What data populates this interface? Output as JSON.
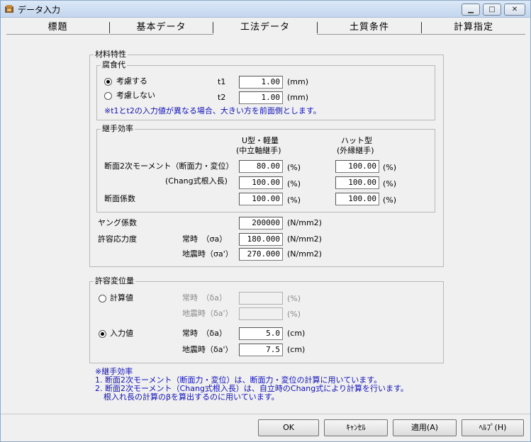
{
  "window": {
    "title": "データ入力"
  },
  "tabs": [
    {
      "label": "標題"
    },
    {
      "label": "基本データ"
    },
    {
      "label": "工法データ"
    },
    {
      "label": "土質条件"
    },
    {
      "label": "計算指定"
    }
  ],
  "material": {
    "title": "材料特性",
    "corrosion": {
      "title": "腐食代",
      "opt_consider": "考慮する",
      "opt_not_consider": "考慮しない",
      "t1_label": "t1",
      "t1_value": "1.00",
      "t1_unit": "(mm)",
      "t2_label": "t2",
      "t2_value": "1.00",
      "t2_unit": "(mm)",
      "note": "※t1とt2の入力値が異なる場合、大きい方を前面側とします。"
    },
    "joint": {
      "title": "継手効率",
      "col1_line1": "U型・軽量",
      "col1_line2": "(中立軸継手)",
      "col2_line1": "ハット型",
      "col2_line2": "(外縁継手)",
      "row1_label": "断面2次モーメント（断面力・変位）",
      "row2_label": "(Chang式根入長)",
      "row3_label": "断面係数",
      "row1_v1": "80.00",
      "row1_v2": "100.00",
      "row2_v1": "100.00",
      "row2_v2": "100.00",
      "row3_v1": "100.00",
      "row3_v2": "100.00",
      "unit": "(%)"
    },
    "young_label": "ヤング係数",
    "young_value": "200000",
    "young_unit": "(N/mm2)",
    "allow_stress_label": "許容応力度",
    "normal_label": "常時　（σa）",
    "normal_value": "180.000",
    "normal_unit": "(N/mm2)",
    "quake_label": "地震時（σa'）",
    "quake_value": "270.000",
    "quake_unit": "(N/mm2)"
  },
  "displacement": {
    "title": "許容変位量",
    "opt_calc": "計算値",
    "calc_normal_label": "常時　（δa）",
    "calc_normal_unit": "(%)",
    "calc_quake_label": "地震時（δa'）",
    "calc_quake_unit": "(%)",
    "opt_input": "入力値",
    "input_normal_label": "常時　（δa）",
    "input_normal_value": "5.0",
    "input_normal_unit": "(cm)",
    "input_quake_label": "地震時（δa'）",
    "input_quake_value": "7.5",
    "input_quake_unit": "(cm)"
  },
  "notes": {
    "line1": "※継手効率",
    "line2": "1. 断面2次モーメント（断面力・変位）は、断面力・変位の計算に用いています。",
    "line3": "2. 断面2次モーメント（Chang式根入長）は、自立時のChang式により計算を行います。",
    "line4": "根入れ長の計算のβを算出するのに用いています。"
  },
  "buttons": {
    "ok": "OK",
    "cancel": "ｷｬﾝｾﾙ",
    "apply": "適用(A)",
    "help": "ﾍﾙﾌﾟ(H)"
  },
  "colors": {
    "note_blue": "#1010b8",
    "disabled_gray": "#8a8a8a"
  }
}
